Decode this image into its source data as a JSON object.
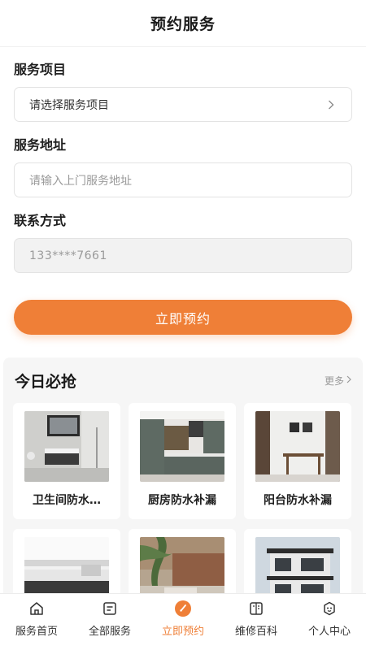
{
  "header": {
    "title": "预约服务"
  },
  "form": {
    "service_item": {
      "label": "服务项目",
      "value": "请选择服务项目"
    },
    "address": {
      "label": "服务地址",
      "placeholder": "请输入上门服务地址"
    },
    "contact": {
      "label": "联系方式",
      "value": "133****7661"
    },
    "submit_label": "立即预约"
  },
  "deals": {
    "title": "今日必抢",
    "more_label": "更多",
    "items": [
      {
        "name": "卫生间防水…"
      },
      {
        "name": "厨房防水补漏"
      },
      {
        "name": "阳台防水补漏"
      },
      {
        "name": ""
      },
      {
        "name": ""
      },
      {
        "name": ""
      }
    ]
  },
  "tabbar": {
    "items": [
      {
        "label": "服务首页",
        "icon": "home-icon"
      },
      {
        "label": "全部服务",
        "icon": "list-icon"
      },
      {
        "label": "立即预约",
        "icon": "booking-icon"
      },
      {
        "label": "维修百科",
        "icon": "book-icon"
      },
      {
        "label": "个人中心",
        "icon": "profile-icon"
      }
    ],
    "active_index": 2
  },
  "colors": {
    "accent": "#ef7f37",
    "disabled_bg": "#f2f2f2",
    "section_bg": "#f6f6f6"
  }
}
